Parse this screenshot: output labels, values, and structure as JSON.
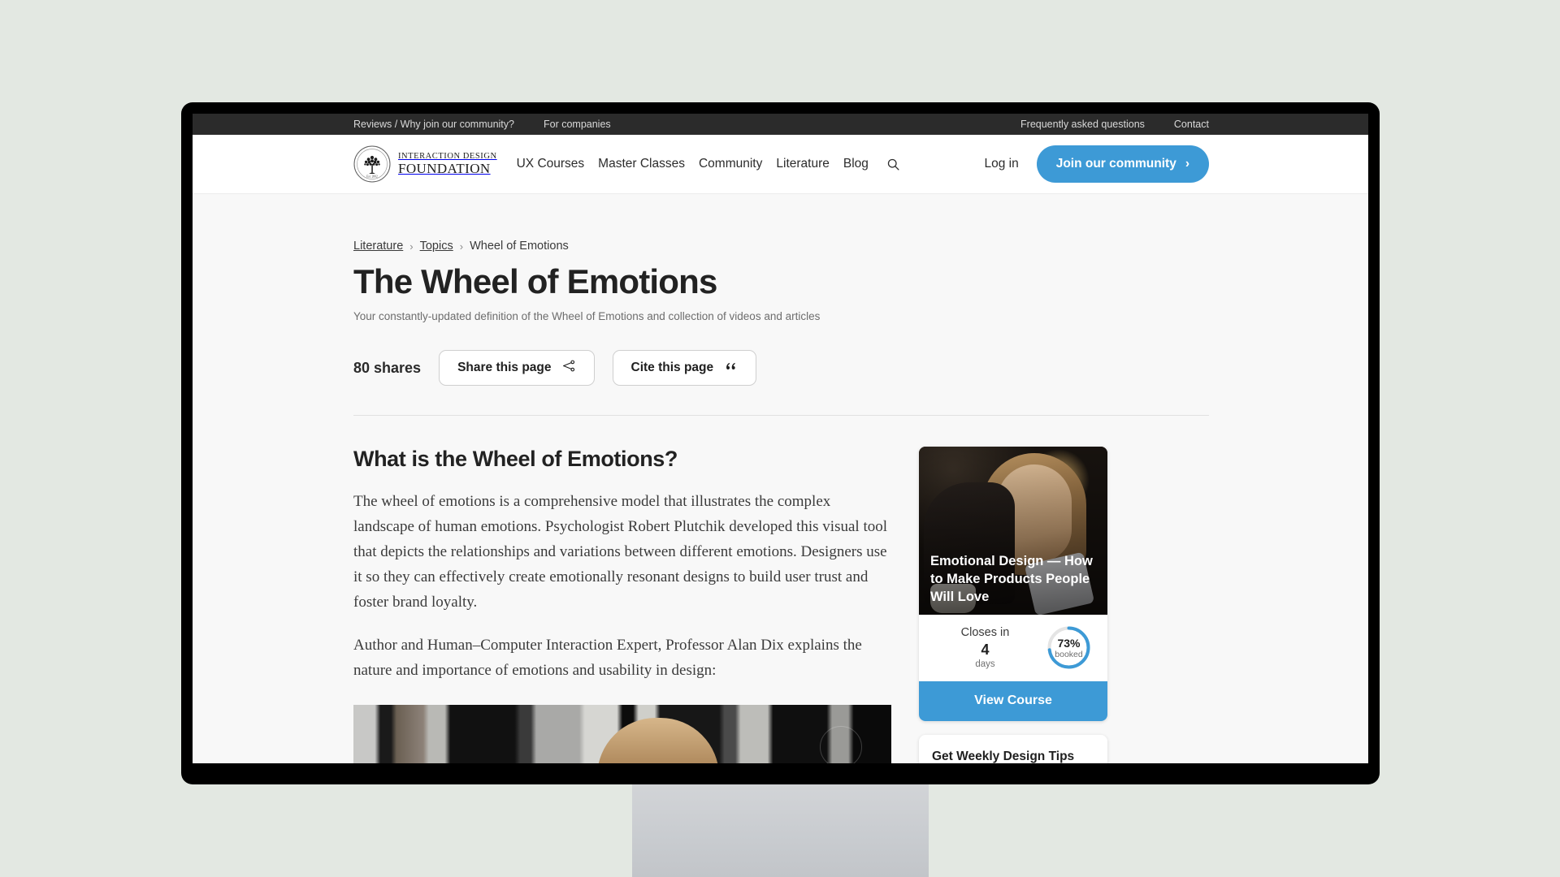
{
  "utility_bar": {
    "left_links": [
      "Reviews / Why join our community?",
      "For companies"
    ],
    "right_links": [
      "Frequently asked questions",
      "Contact"
    ]
  },
  "header": {
    "logo": {
      "line1": "INTERACTION DESIGN",
      "line2": "FOUNDATION",
      "seal_text": "Est. 2002"
    },
    "nav": [
      "UX Courses",
      "Master Classes",
      "Community",
      "Literature",
      "Blog"
    ],
    "login_label": "Log in",
    "join_label": "Join our community",
    "join_chevron": "›",
    "accent_color": "#3d9ad6"
  },
  "breadcrumb": {
    "items": [
      "Literature",
      "Topics",
      "Wheel of Emotions"
    ],
    "separator": "›"
  },
  "page": {
    "title": "The Wheel of Emotions",
    "subtitle": "Your constantly-updated definition of the Wheel of Emotions and collection of videos and articles",
    "share_count": "80 shares",
    "share_button": "Share this page",
    "cite_button": "Cite this page",
    "cite_icon_glyph": "““"
  },
  "main": {
    "heading": "What is the Wheel of Emotions?",
    "paragraph_1": "The wheel of emotions is a comprehensive model that illustrates the complex landscape of human emotions. Psychologist Robert Plutchik developed this visual tool that depicts the relationships and variations between different emotions. Designers use it so they can effectively create emotionally resonant designs to build user trust and foster brand loyalty.",
    "paragraph_2": "Author and Human–Computer Interaction Expert, Professor Alan Dix explains the nature and importance of emotions and usability in design:"
  },
  "sidebar": {
    "course_card": {
      "title": "Emotional Design — How to Make Products People Will Love",
      "closes_label": "Closes in",
      "closes_number": "4",
      "closes_unit": "days",
      "booked_percent": "73%",
      "booked_label": "booked",
      "booked_value": 73,
      "ring_color": "#3d9ad6",
      "cta_label": "View Course"
    },
    "tips_card": {
      "title": "Get Weekly Design Tips"
    }
  }
}
